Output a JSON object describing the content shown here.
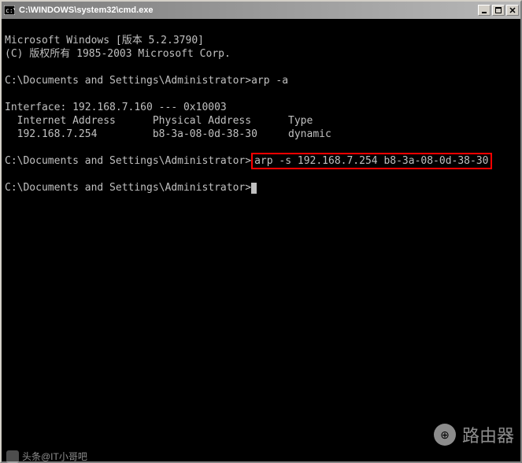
{
  "titlebar": {
    "icon": "cmd-icon",
    "text": "C:\\WINDOWS\\system32\\cmd.exe",
    "minimize": "_",
    "maximize": "□",
    "close": "×"
  },
  "terminal": {
    "line1": "Microsoft Windows [版本 5.2.3790]",
    "line2": "(C) 版权所有 1985-2003 Microsoft Corp.",
    "line3": "",
    "prompt1": "C:\\Documents and Settings\\Administrator>",
    "cmd1": "arp -a",
    "line5": "",
    "line6": "Interface: 192.168.7.160 --- 0x10003",
    "line7": "  Internet Address      Physical Address      Type",
    "line8": "  192.168.7.254         b8-3a-08-0d-38-30     dynamic",
    "line9": "",
    "prompt2": "C:\\Documents and Settings\\Administrator>",
    "cmd2": "arp -s 192.168.7.254 b8-3a-08-0d-38-30",
    "line11": "",
    "prompt3": "C:\\Documents and Settings\\Administrator>"
  },
  "watermark": {
    "text": "路由器",
    "logo_glyph": "⊕"
  },
  "footer": {
    "text": "头条@IT小哥吧"
  }
}
